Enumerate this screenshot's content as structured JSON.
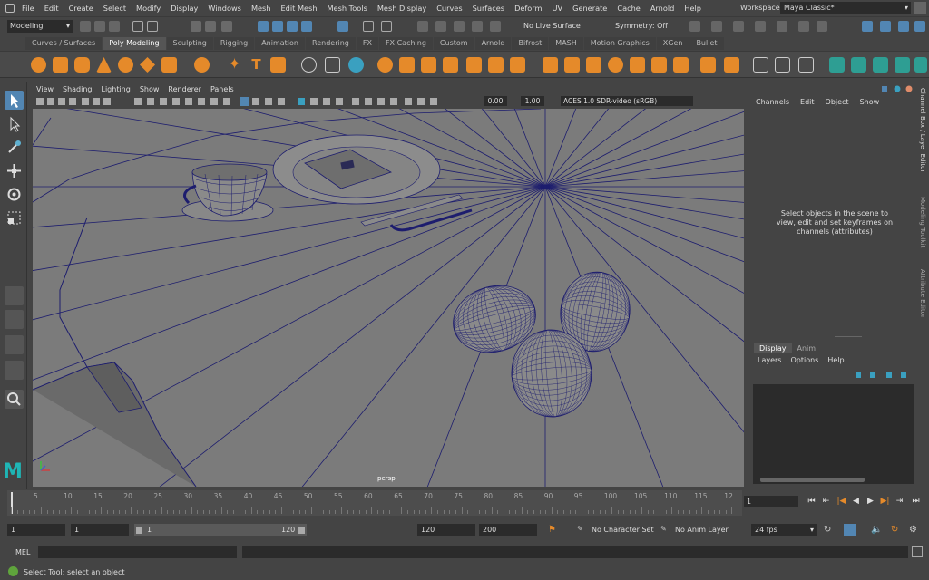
{
  "menubar": {
    "items": [
      "File",
      "Edit",
      "Create",
      "Select",
      "Modify",
      "Display",
      "Windows",
      "Mesh",
      "Edit Mesh",
      "Mesh Tools",
      "Mesh Display",
      "Curves",
      "Surfaces",
      "Deform",
      "UV",
      "Generate",
      "Cache",
      "Arnold",
      "Help"
    ],
    "workspace_label": "Workspace:",
    "workspace_value": "Maya Classic*"
  },
  "statusline": {
    "mode": "Modeling",
    "live_surface": "No Live Surface",
    "symmetry": "Symmetry: Off"
  },
  "shelf": {
    "tabs": [
      "Curves / Surfaces",
      "Poly Modeling",
      "Sculpting",
      "Rigging",
      "Animation",
      "Rendering",
      "FX",
      "FX Caching",
      "Custom",
      "Arnold",
      "Bifrost",
      "MASH",
      "Motion Graphics",
      "XGen",
      "Bullet"
    ],
    "active_tab": "Poly Modeling",
    "accent_color": "#e58a2a"
  },
  "viewport": {
    "menu": [
      "View",
      "Shading",
      "Lighting",
      "Show",
      "Renderer",
      "Panels"
    ],
    "gamma": "0.00",
    "exposure": "1.00",
    "color_space": "ACES 1.0 SDR-video (sRGB)",
    "camera_label": "persp",
    "wire_color": "#1d1d6e",
    "background_color": "#7b7b7b"
  },
  "channelbox": {
    "menu": [
      "Channels",
      "Edit",
      "Object",
      "Show"
    ],
    "message_line1": "Select objects in the scene to",
    "message_line2": "view, edit and set keyframes on",
    "message_line3": "channels (attributes)",
    "layer_tabs": [
      "Display",
      "Anim"
    ],
    "active_layer_tab": "Display",
    "layer_menu": [
      "Layers",
      "Options",
      "Help"
    ],
    "side_tabs": [
      "Channel Box / Layer Editor",
      "Modeling Toolkit",
      "Attribute Editor"
    ]
  },
  "timeslider": {
    "ticks": [
      "5",
      "10",
      "15",
      "20",
      "25",
      "30",
      "35",
      "40",
      "45",
      "50",
      "55",
      "60",
      "65",
      "70",
      "75",
      "80",
      "85",
      "90",
      "95",
      "100",
      "105",
      "110",
      "115",
      "12"
    ],
    "current_frame": "1"
  },
  "range": {
    "start_time": "1",
    "playback_start": "1",
    "slider_start": "1",
    "slider_end": "120",
    "playback_end": "120",
    "end_time": "200",
    "character_set": "No Character Set",
    "anim_layer": "No Anim Layer",
    "fps": "24 fps"
  },
  "cmdline": {
    "label": "MEL"
  },
  "helpline": {
    "text": "Select Tool: select an object"
  }
}
